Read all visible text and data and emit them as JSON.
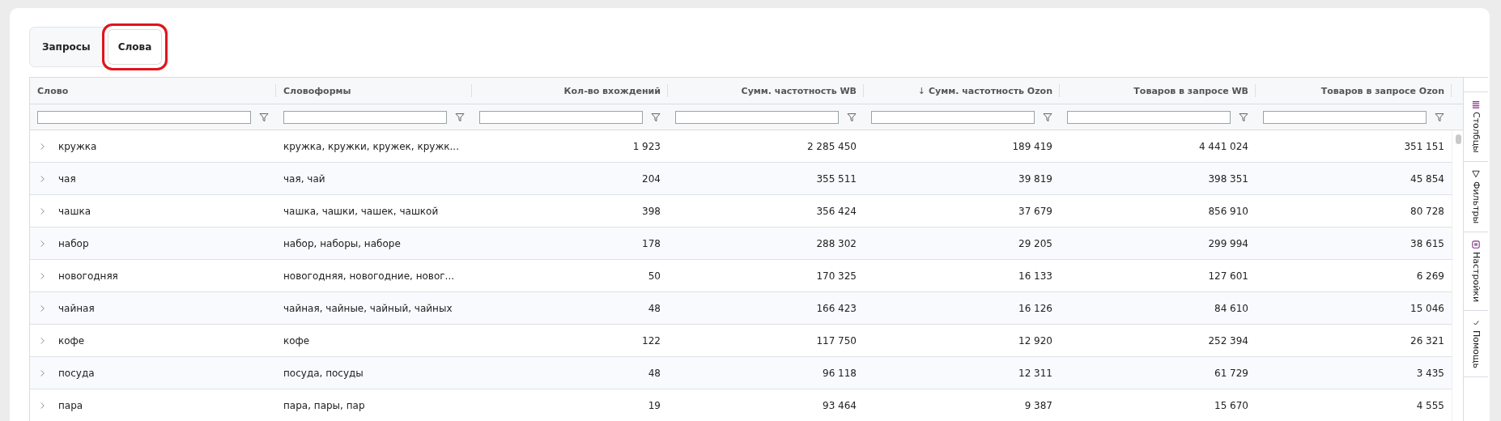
{
  "tabs": [
    {
      "label": "Запросы",
      "selected": false
    },
    {
      "label": "Слова",
      "selected": true
    }
  ],
  "table": {
    "columns": [
      {
        "label": "Слово",
        "kind": "text"
      },
      {
        "label": "Словоформы",
        "kind": "text"
      },
      {
        "label": "Кол-во вхождений",
        "kind": "number"
      },
      {
        "label": "Сумм. частотность WB",
        "kind": "number"
      },
      {
        "label": "Сумм. частотность Ozon",
        "kind": "number",
        "sort_indicator": "↓"
      },
      {
        "label": "Товаров в запросе WB",
        "kind": "number"
      },
      {
        "label": "Товаров в запросе Ozon",
        "kind": "number"
      }
    ],
    "rows": [
      [
        "кружка",
        "кружка, кружки, кружек, кружк...",
        "1 923",
        "2 285 450",
        "189 419",
        "4 441 024",
        "351 151"
      ],
      [
        "чая",
        "чая, чай",
        "204",
        "355 511",
        "39 819",
        "398 351",
        "45 854"
      ],
      [
        "чашка",
        "чашка, чашки, чашек, чашкой",
        "398",
        "356 424",
        "37 679",
        "856 910",
        "80 728"
      ],
      [
        "набор",
        "набор, наборы, наборе",
        "178",
        "288 302",
        "29 205",
        "299 994",
        "38 615"
      ],
      [
        "новогодняя",
        "новогодняя, новогодние, новог...",
        "50",
        "170 325",
        "16 133",
        "127 601",
        "6 269"
      ],
      [
        "чайная",
        "чайная, чайные, чайный, чайных",
        "48",
        "166 423",
        "16 126",
        "84 610",
        "15 046"
      ],
      [
        "кофе",
        "кофе",
        "122",
        "117 750",
        "12 920",
        "252 394",
        "26 321"
      ],
      [
        "посуда",
        "посуда, посуды",
        "48",
        "96 118",
        "12 311",
        "61 729",
        "3 435"
      ],
      [
        "пара",
        "пара, пары, пар",
        "19",
        "93 464",
        "9 387",
        "15 670",
        "4 555"
      ]
    ]
  },
  "side_panel": [
    {
      "label": "Столбцы",
      "kind": "columns"
    },
    {
      "label": "Фильтры",
      "kind": "filter"
    },
    {
      "label": "Настройки",
      "kind": "settings"
    },
    {
      "label": "Помощь",
      "kind": "help"
    }
  ]
}
